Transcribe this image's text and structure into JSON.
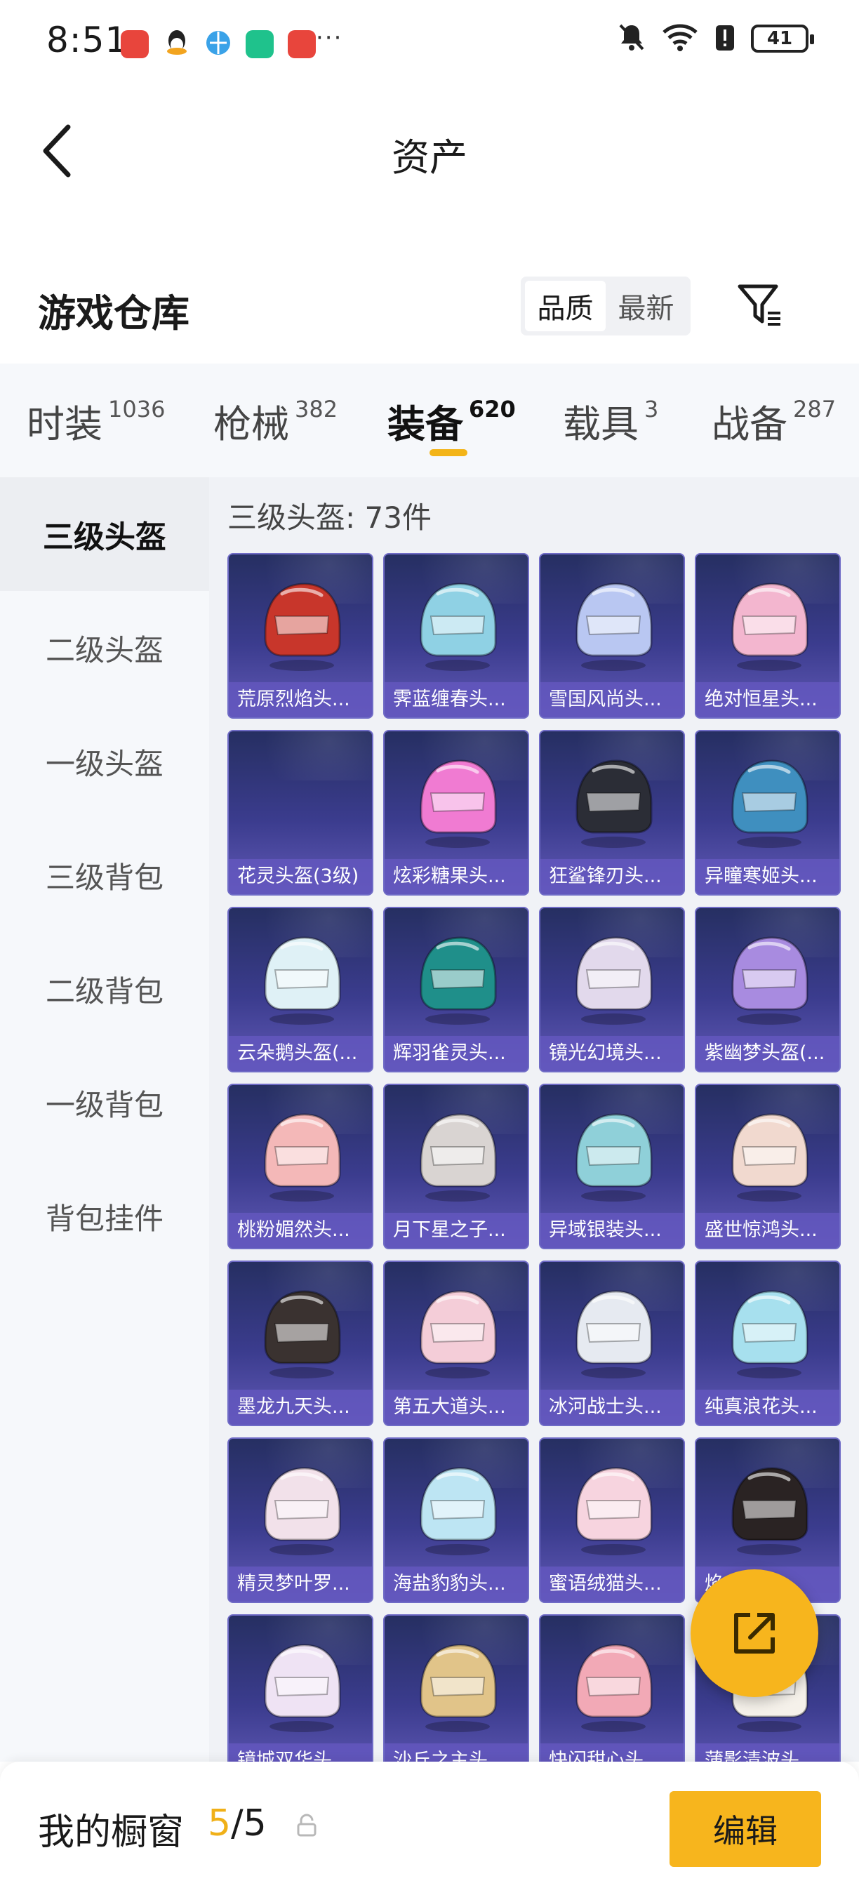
{
  "status_bar": {
    "time": "8:51",
    "battery": "41",
    "more_dots": "···",
    "app_icons": [
      "huawei-app-icon",
      "qq-icon",
      "browser-icon",
      "security-icon",
      "huawei-app-icon"
    ],
    "indicators": [
      "mute-icon",
      "wifi-icon",
      "alert-icon"
    ]
  },
  "header": {
    "title": "资产"
  },
  "section": {
    "title": "游戏仓库",
    "sort_options": [
      "品质",
      "最新"
    ],
    "sort_selected": "品质"
  },
  "tabs": [
    {
      "label": "时装",
      "count": "1036"
    },
    {
      "label": "枪械",
      "count": "382"
    },
    {
      "label": "装备",
      "count": "620",
      "active": true
    },
    {
      "label": "载具",
      "count": "3"
    },
    {
      "label": "战备",
      "count": "287"
    }
  ],
  "sidebar": {
    "items": [
      "三级头盔",
      "二级头盔",
      "一级头盔",
      "三级背包",
      "二级背包",
      "一级背包",
      "背包挂件"
    ],
    "selected": "三级头盔"
  },
  "content": {
    "count_title": "三级头盔: 73件",
    "items": [
      {
        "name": "荒原烈焰头...",
        "color": "#c8362b"
      },
      {
        "name": "霁蓝缠春头...",
        "color": "#8fd1e4"
      },
      {
        "name": "雪国风尚头...",
        "color": "#b9c7f2"
      },
      {
        "name": "绝对恒星头...",
        "color": "#f3b6cf"
      },
      {
        "name": "花灵头盔(3级)",
        "color": ""
      },
      {
        "name": "炫彩糖果头...",
        "color": "#f07bd2"
      },
      {
        "name": "狂鲨锋刃头...",
        "color": "#2b2d36"
      },
      {
        "name": "异瞳寒姬头...",
        "color": "#3f8fbf"
      },
      {
        "name": "云朵鹅头盔(...",
        "color": "#dff1f6"
      },
      {
        "name": "辉羽雀灵头...",
        "color": "#1f8f8a"
      },
      {
        "name": "镜光幻境头...",
        "color": "#e2d9ec"
      },
      {
        "name": "紫幽梦头盔(...",
        "color": "#a88be0"
      },
      {
        "name": "桃粉媚然头...",
        "color": "#f4b8b8"
      },
      {
        "name": "月下星之子...",
        "color": "#d9d4d2"
      },
      {
        "name": "异域银装头...",
        "color": "#8fd0d9"
      },
      {
        "name": "盛世惊鸿头...",
        "color": "#f1d9cf"
      },
      {
        "name": "墨龙九天头...",
        "color": "#3a3230"
      },
      {
        "name": "第五大道头...",
        "color": "#f4cdd8"
      },
      {
        "name": "冰河战士头...",
        "color": "#e6eaf1"
      },
      {
        "name": "纯真浪花头...",
        "color": "#a7e0ee"
      },
      {
        "name": "精灵梦叶罗...",
        "color": "#f2e1ea"
      },
      {
        "name": "海盐豹豹头...",
        "color": "#bde5f3"
      },
      {
        "name": "蜜语绒猫头...",
        "color": "#f7d4df"
      },
      {
        "name": "焰...头...",
        "color": "#2a2323"
      },
      {
        "name": "镜城双华头...",
        "color": "#efe3f4"
      },
      {
        "name": "沙丘之主头...",
        "color": "#e1c489"
      },
      {
        "name": "快闪甜心头...",
        "color": "#f2a9b6"
      },
      {
        "name": "蒲影清波头...",
        "color": "#f5f1ea"
      }
    ]
  },
  "bottom_bar": {
    "label": "我的橱窗",
    "current": "5",
    "total": "/5",
    "edit_label": "编辑"
  },
  "colors": {
    "accent": "#f7b51d",
    "card_top": "#262f62",
    "card_bottom": "#6159b6"
  }
}
